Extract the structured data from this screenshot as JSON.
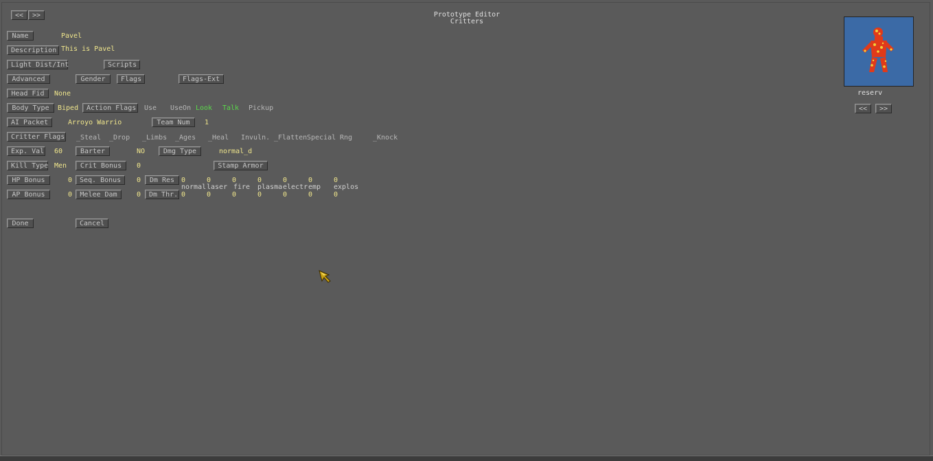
{
  "top_buttons": {
    "back": "<<",
    "forward": ">>"
  },
  "header": {
    "title": "Prototype Editor",
    "subtitle": "Critters"
  },
  "portrait": {
    "name": "reserv",
    "prev": "<<",
    "next": ">>"
  },
  "fields": {
    "name": {
      "label": "Name",
      "value": "Pavel"
    },
    "description": {
      "label": "Description",
      "value": "This is Pavel"
    },
    "light": {
      "label": "Light Dist/Int"
    },
    "scripts": {
      "label": "Scripts"
    },
    "advanced": {
      "label": "Advanced"
    },
    "gender": {
      "label": "Gender"
    },
    "flags": {
      "label": "Flags"
    },
    "flags_ext": {
      "label": "Flags-Ext"
    },
    "head_fid": {
      "label": "Head Fid",
      "value": "None"
    },
    "body_type": {
      "label": "Body Type",
      "value": "Biped"
    },
    "action_flags": {
      "label": "Action Flags",
      "use": "Use",
      "useon": "UseOn",
      "look": "Look",
      "talk": "Talk",
      "pickup": "Pickup"
    },
    "ai_packet": {
      "label": "AI Packet",
      "value": "Arroyo Warrio"
    },
    "team_num": {
      "label": "Team Num",
      "value": "1"
    },
    "critter_flags": {
      "label": "Critter Flags",
      "steal": "_Steal",
      "drop": "_Drop",
      "limbs": "_Limbs",
      "ages": "_Ages",
      "heal": "_Heal",
      "invuln": "Invuln.",
      "flatten": "_Flatten",
      "special": "Special",
      "rng": "Rng",
      "knock": "_Knock"
    },
    "exp_val": {
      "label": "Exp. Val",
      "value": "60"
    },
    "barter": {
      "label": "Barter",
      "value": "NO"
    },
    "dmg_type": {
      "label": "Dmg Type",
      "value": "normal_d"
    },
    "kill_type": {
      "label": "Kill Type",
      "value": "Men"
    },
    "crit_bonus": {
      "label": "Crit Bonus",
      "value": "0"
    },
    "stamp_armor": {
      "label": "Stamp Armor"
    },
    "hp_bonus": {
      "label": "HP Bonus",
      "value": "0"
    },
    "seq_bonus": {
      "label": "Seq. Bonus",
      "value": "0"
    },
    "dm_res": {
      "label": "Dm Res",
      "values": [
        "0",
        "0",
        "0",
        "0",
        "0",
        "0",
        "0"
      ]
    },
    "ap_bonus": {
      "label": "AP Bonus",
      "value": "0"
    },
    "melee_dam": {
      "label": "Melee Dam",
      "value": "0"
    },
    "dm_thr": {
      "label": "Dm Thr.",
      "values": [
        "0",
        "0",
        "0",
        "0",
        "0",
        "0",
        "0"
      ]
    },
    "dmg_names": [
      "normal",
      "laser",
      "fire",
      "plasma",
      "electr",
      "emp",
      "explos"
    ]
  },
  "actions": {
    "done": "Done",
    "cancel": "Cancel"
  }
}
